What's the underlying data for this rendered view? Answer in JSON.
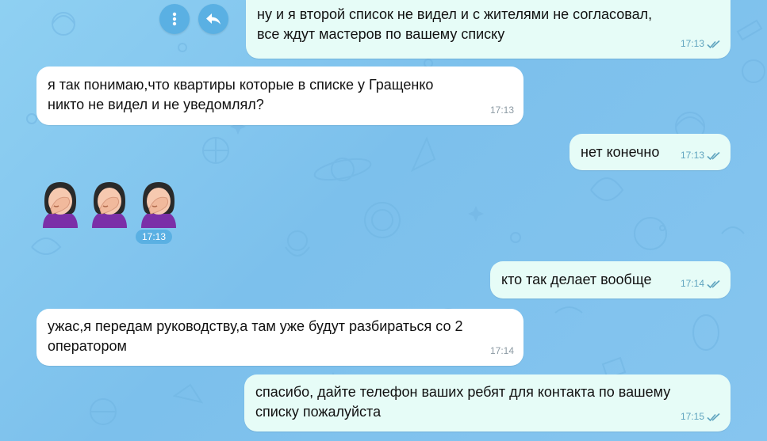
{
  "chat": {
    "messages": [
      {
        "id": "m1",
        "direction": "out",
        "text": "ну и я второй список не видел и с жителями не согласовал,\nвсе ждут мастеров по вашему списку",
        "time": "17:13",
        "status": "read"
      },
      {
        "id": "m2",
        "direction": "in",
        "text": "я так понимаю,что квартиры которые в списке у Гращенко\nникто не видел и не уведомлял?",
        "time": "17:13"
      },
      {
        "id": "m3",
        "direction": "out",
        "text": "нет конечно",
        "time": "17:13",
        "status": "read"
      },
      {
        "id": "m4",
        "direction": "in",
        "type": "emoji",
        "emoji": "🤦‍♀️🤦‍♀️🤦‍♀️",
        "time": "17:13"
      },
      {
        "id": "m5",
        "direction": "out",
        "text": "кто так делает вообще",
        "time": "17:14",
        "status": "read"
      },
      {
        "id": "m6",
        "direction": "in",
        "text": "ужас,я передам руководству,а там уже будут разбираться со 2\nоператором",
        "time": "17:14"
      },
      {
        "id": "m7",
        "direction": "out",
        "text": "спасибо, дайте телефон ваших ребят для контакта по вашему\nсписку пожалуйста",
        "time": "17:15",
        "status": "read"
      }
    ],
    "actions": {
      "more_icon": "more-vertical-icon",
      "reply_icon": "reply-icon"
    }
  },
  "theme": {
    "accent": "#5ab0e3",
    "outgoing_bubble": "#e6fcf7",
    "incoming_bubble": "#ffffff",
    "read_ticks": "#5fa4bf"
  }
}
